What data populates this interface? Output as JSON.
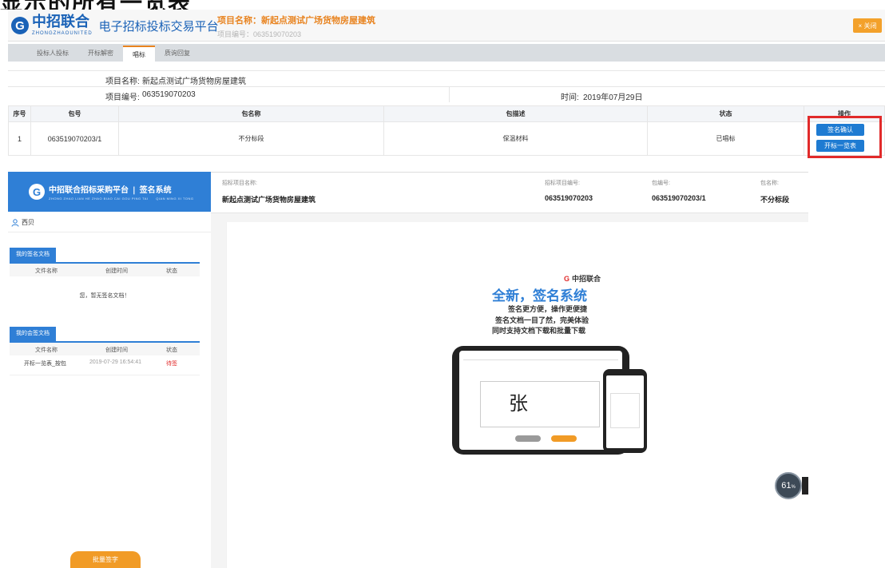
{
  "caption": "显示的所有一览表",
  "header": {
    "logo_cn": "中招联合",
    "logo_en": "ZHONGZHAOUNITED",
    "platform": "电子招标投标交易平台",
    "project_title": "项目名称：新起点测试广场货物房屋建筑",
    "project_code_line": "项目编号：063519070203",
    "close_label": "× 关闭"
  },
  "tabs": [
    {
      "label": "投标人投标"
    },
    {
      "label": "开标解密"
    },
    {
      "label": "唱标",
      "active": true
    },
    {
      "label": "质询回复"
    }
  ],
  "info": {
    "name_label": "项目名称:",
    "name_value": "新起点测试广场货物房屋建筑",
    "code_label": "项目编号:",
    "code_value": "063519070203",
    "time_label": "时间:",
    "time_value": "2019年07月29日"
  },
  "table": {
    "headers": [
      "序号",
      "包号",
      "包名称",
      "包描述",
      "状态",
      "操作"
    ],
    "rows": [
      {
        "index": "1",
        "package_no": "063519070203/1",
        "package_name": "不分标段",
        "description": "保温材料",
        "status": "已唱标"
      }
    ],
    "btn_sign": "签名确认",
    "btn_open": "开标一览表"
  },
  "signing": {
    "logo": "G",
    "title": "中招联合招标采购平台",
    "divider": "|",
    "system": "签名系统",
    "subtitle": "ZHONG ZHAO LIAN HE ZHAO BIAO CAI GOU PING TAI",
    "system_en": "QIAN MING XI TONG",
    "cols": [
      {
        "label": "招标项目名称:",
        "value": "新起点测试广场货物房屋建筑"
      },
      {
        "label": "招标项目编号:",
        "value": "063519070203"
      },
      {
        "label": "包编号:",
        "value": "063519070203/1"
      },
      {
        "label": "包名称:",
        "value": "不分标段"
      }
    ],
    "user": "西贝",
    "my_docs_tab": "我的签名文档",
    "my_cosign_tab": "我的会签文档",
    "doc_headers": [
      "文件名称",
      "创建时间",
      "状态"
    ],
    "empty_msg": "您，暂无签名文档！",
    "cosign_row": {
      "name": "开标一览表_按包",
      "time": "2019-07-29 16:54:41",
      "status": "待签"
    },
    "batch_sign": "批量签字"
  },
  "ad": {
    "brand": "中招联合",
    "headline": "全新，签名系统",
    "lines": [
      "签名更方便，操作更便捷",
      "签名文档一目了然，完美体验",
      "同时支持文档下载和批量下载"
    ],
    "sign_char": "张"
  },
  "zoom": {
    "value": "61",
    "unit": "%"
  },
  "colors": {
    "brand_blue": "#1a62b7",
    "accent_orange": "#e8831f",
    "highlight_red": "#e12a2a",
    "button_blue": "#1e7bd2"
  }
}
